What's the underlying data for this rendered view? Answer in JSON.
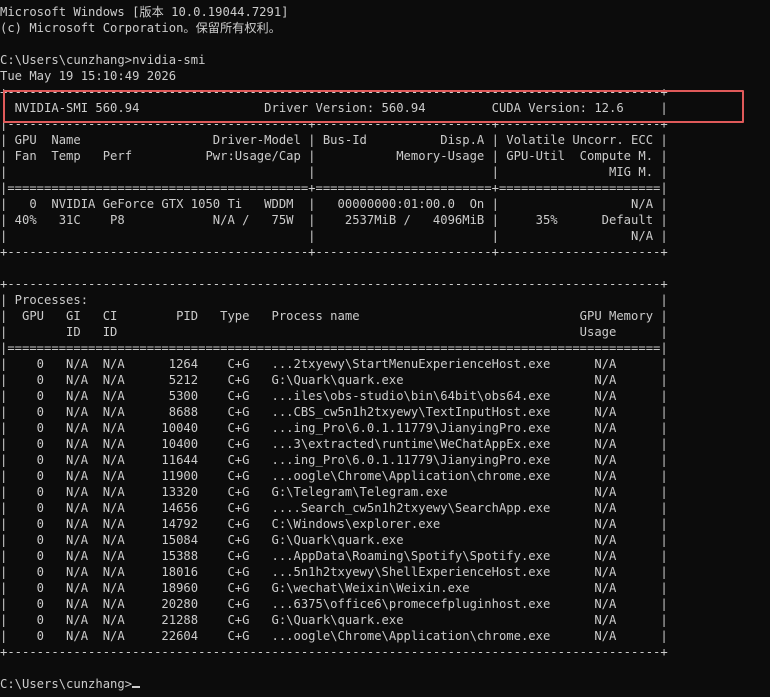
{
  "terminal": {
    "lines": [
      "Microsoft Windows [版本 10.0.19044.7291]",
      "(c) Microsoft Corporation。保留所有权利。",
      "",
      "C:\\Users\\cunzhang>nvidia-smi",
      "Tue May 19 15:10:49 2026",
      "+-----------------------------------------------------------------------------------------+",
      "| NVIDIA-SMI 560.94                 Driver Version: 560.94         CUDA Version: 12.6     |",
      "|-----------------------------------------+------------------------+----------------------+",
      "| GPU  Name                  Driver-Model | Bus-Id          Disp.A | Volatile Uncorr. ECC |",
      "| Fan  Temp   Perf          Pwr:Usage/Cap |           Memory-Usage | GPU-Util  Compute M. |",
      "|                                         |                        |               MIG M. |",
      "|=========================================+========================+======================|",
      "|   0  NVIDIA GeForce GTX 1050 Ti   WDDM  |   00000000:01:00.0  On |                  N/A |",
      "| 40%   31C    P8            N/A /   75W  |    2537MiB /   4096MiB |     35%      Default |",
      "|                                         |                        |                  N/A |",
      "+-----------------------------------------+------------------------+----------------------+",
      "",
      "+-----------------------------------------------------------------------------------------+",
      "| Processes:                                                                              |",
      "|  GPU   GI   CI        PID   Type   Process name                              GPU Memory |",
      "|        ID   ID                                                               Usage      |",
      "|=========================================================================================|",
      "|    0   N/A  N/A      1264    C+G   ...2txyewy\\StartMenuExperienceHost.exe      N/A      |",
      "|    0   N/A  N/A      5212    C+G   G:\\Quark\\quark.exe                          N/A      |",
      "|    0   N/A  N/A      5300    C+G   ...iles\\obs-studio\\bin\\64bit\\obs64.exe      N/A      |",
      "|    0   N/A  N/A      8688    C+G   ...CBS_cw5n1h2txyewy\\TextInputHost.exe      N/A      |",
      "|    0   N/A  N/A     10040    C+G   ...ing_Pro\\6.0.1.11779\\JianyingPro.exe      N/A      |",
      "|    0   N/A  N/A     10400    C+G   ...3\\extracted\\runtime\\WeChatAppEx.exe      N/A      |",
      "|    0   N/A  N/A     11644    C+G   ...ing_Pro\\6.0.1.11779\\JianyingPro.exe      N/A      |",
      "|    0   N/A  N/A     11900    C+G   ...oogle\\Chrome\\Application\\chrome.exe      N/A      |",
      "|    0   N/A  N/A     13320    C+G   G:\\Telegram\\Telegram.exe                    N/A      |",
      "|    0   N/A  N/A     14656    C+G   ....Search_cw5n1h2txyewy\\SearchApp.exe      N/A      |",
      "|    0   N/A  N/A     14792    C+G   C:\\Windows\\explorer.exe                     N/A      |",
      "|    0   N/A  N/A     15084    C+G   G:\\Quark\\quark.exe                          N/A      |",
      "|    0   N/A  N/A     15388    C+G   ...AppData\\Roaming\\Spotify\\Spotify.exe      N/A      |",
      "|    0   N/A  N/A     18016    C+G   ...5n1h2txyewy\\ShellExperienceHost.exe      N/A      |",
      "|    0   N/A  N/A     18960    C+G   G:\\wechat\\Weixin\\Weixin.exe                 N/A      |",
      "|    0   N/A  N/A     20280    C+G   ...6375\\office6\\promecefpluginhost.exe      N/A      |",
      "|    0   N/A  N/A     21288    C+G   G:\\Quark\\quark.exe                          N/A      |",
      "|    0   N/A  N/A     22604    C+G   ...oogle\\Chrome\\Application\\chrome.exe      N/A      |",
      "+-----------------------------------------------------------------------------------------+",
      "",
      "C:\\Users\\cunzhang>"
    ]
  },
  "colors": {
    "background": "#0c0c0c",
    "text": "#cccccc",
    "highlight": "#e05a5a"
  }
}
